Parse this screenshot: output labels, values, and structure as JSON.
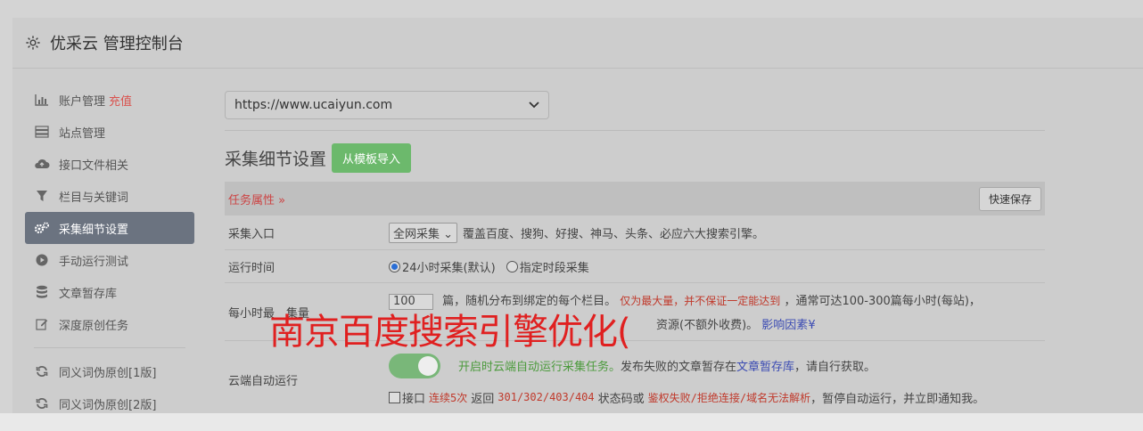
{
  "header": {
    "title": "优采云 管理控制台"
  },
  "sidebar": {
    "items": [
      {
        "label": "账户管理",
        "extra": "充值",
        "icon": "bar-chart-icon"
      },
      {
        "label": "站点管理",
        "icon": "server-icon"
      },
      {
        "label": "接口文件相关",
        "icon": "cloud-upload-icon"
      },
      {
        "label": "栏目与关键词",
        "icon": "filter-icon"
      },
      {
        "label": "采集细节设置",
        "icon": "gears-icon",
        "active": true
      },
      {
        "label": "手动运行测试",
        "icon": "play-icon"
      },
      {
        "label": "文章暂存库",
        "icon": "database-icon"
      },
      {
        "label": "深度原创任务",
        "icon": "edit-icon"
      },
      {
        "label": "同义词伪原创[1版]",
        "icon": "refresh-icon"
      },
      {
        "label": "同义词伪原创[2版]",
        "icon": "refresh-icon"
      }
    ]
  },
  "main": {
    "site_select": "https://www.ucaiyun.com",
    "section_title": "采集细节设置",
    "import_button": "从模板导入",
    "task_props": "任务属性",
    "quick_save": "快速保存",
    "rows": {
      "entry": {
        "label": "采集入口",
        "select": "全网采集",
        "desc": "覆盖百度、搜狗、好搜、神马、头条、必应六大搜索引擎。"
      },
      "runtime": {
        "label": "运行时间",
        "opt1": "24小时采集(默认)",
        "opt2": "指定时段采集"
      },
      "perhour": {
        "label": "每小时最",
        "label_tail": "集量",
        "value": "100",
        "text1": "篇，随机分布到绑定的每个栏目。",
        "red1": "仅为最大量，并不保证一定能达到",
        "text2": "，通常可达100-300篇每小时(每站)，",
        "text3": "资源(不额外收费)。",
        "link": "影响因素"
      },
      "cloud": {
        "label": "云端自动运行",
        "green": "开启时云端自动运行采集任务。",
        "text1": "发布失败的文章暂存在",
        "link": "文章暂存库",
        "text2": "，请自行获取。",
        "chk_label": "接口",
        "red1": "连续5次",
        "text3": "返回",
        "codes": "301/302/403/404",
        "text4": "状态码或",
        "red2": "鉴权失败/拒绝连接/域名无法解析",
        "text5": "，暂停自动运行，并立即通知我。"
      }
    }
  },
  "watermark": "南京百度搜索引擎优化("
}
